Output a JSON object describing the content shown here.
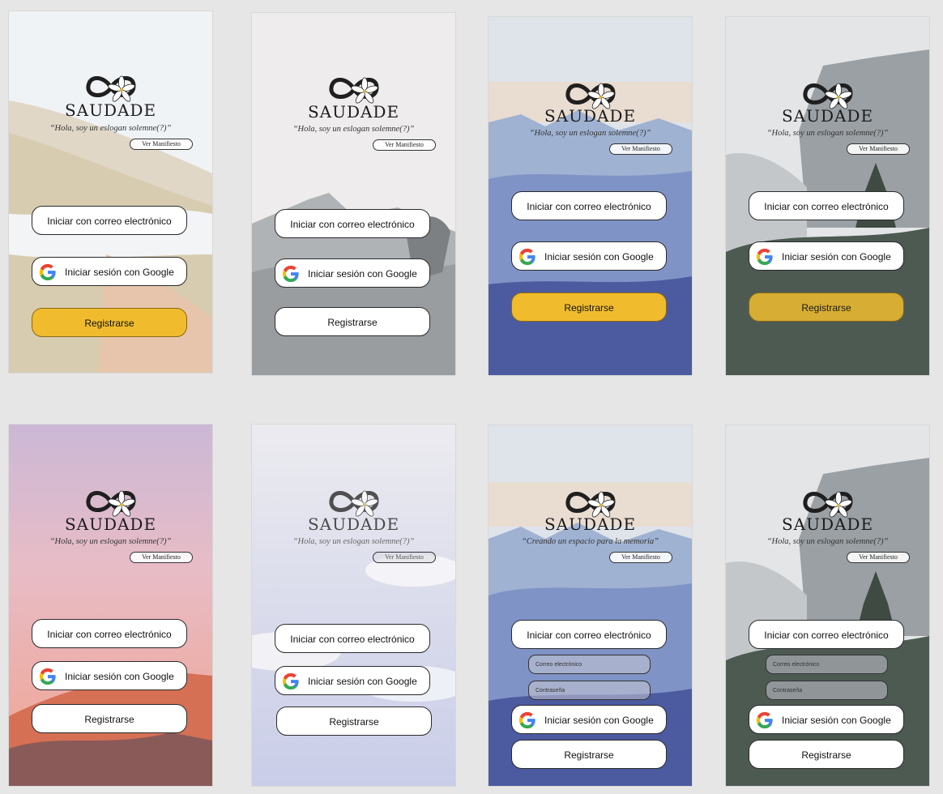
{
  "brand": "SAUDADE",
  "slogan": "“Hola, soy un eslogan solemne(?)”",
  "slogan_alt": "“Creando un espacio para la memoria”",
  "manifest_label": "Ver Manifiesto",
  "email_button_label": "Iniciar con correo electrónico",
  "google_button_label": "Iniciar sesión con Google",
  "register_label": "Registrarse",
  "email_placeholder": "Correo electrónico",
  "password_placeholder": "Contraseña",
  "icons": {
    "logo": "infinity-lily-logo-icon",
    "google": "google-g-icon"
  },
  "colors": {
    "accent": "#f0bc2e",
    "page_background": "#e6e6e6"
  }
}
